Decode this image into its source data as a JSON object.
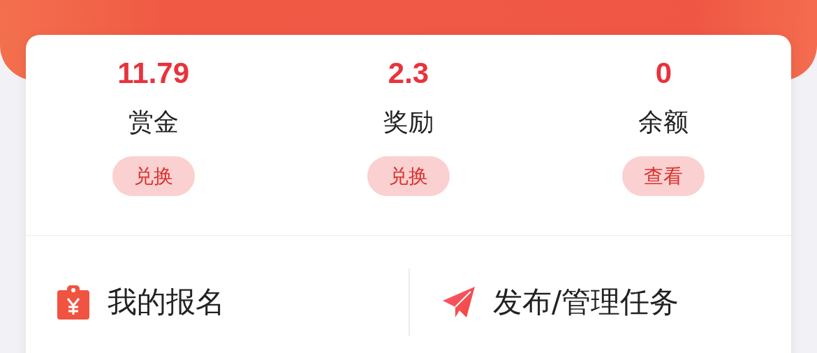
{
  "stats": [
    {
      "value": "11.79",
      "label": "赏金",
      "action": "兑换"
    },
    {
      "value": "2.3",
      "label": "奖励",
      "action": "兑换"
    },
    {
      "value": "0",
      "label": "余额",
      "action": "查看"
    }
  ],
  "links": [
    {
      "kind": "clipboard",
      "label": "我的报名"
    },
    {
      "kind": "plane",
      "label": "发布/管理任务"
    }
  ]
}
